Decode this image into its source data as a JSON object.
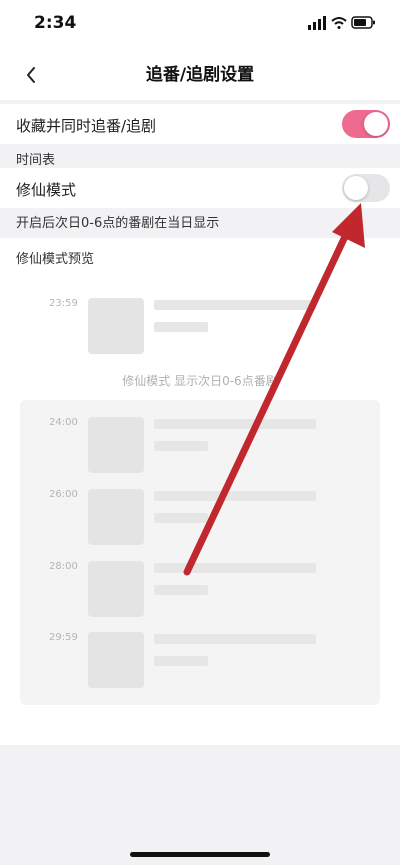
{
  "status_bar": {
    "time": "2:34"
  },
  "nav": {
    "title": "追番/追剧设置"
  },
  "settings": {
    "collect_follow": {
      "label": "收藏并同时追番/追剧",
      "enabled": true
    },
    "timetable_section": "时间表",
    "xiuxian_mode": {
      "label": "修仙模式",
      "enabled": false
    },
    "xiuxian_desc": "开启后次日0-6点的番剧在当日显示"
  },
  "preview": {
    "title": "修仙模式预览",
    "normal_time": "23:59",
    "mode_caption": "修仙模式 显示次日0-6点番剧",
    "mode_times": [
      "24:00",
      "26:00",
      "28:00",
      "29:59"
    ]
  },
  "colors": {
    "accent": "#ee6a8e",
    "annotation_arrow": "#c0282d"
  }
}
